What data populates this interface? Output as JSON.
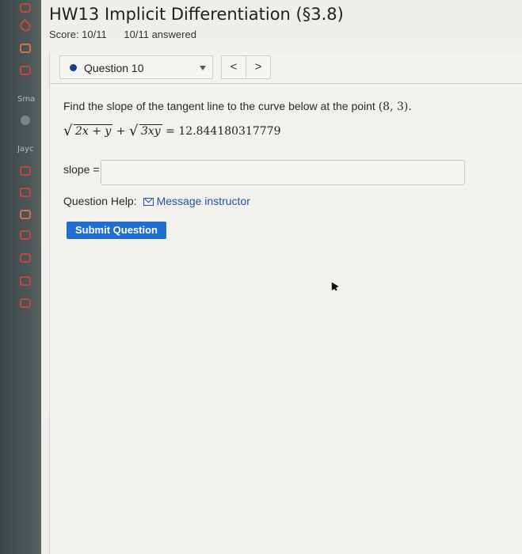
{
  "sidebar": {
    "labels": [
      "Sma",
      "Jayc"
    ]
  },
  "header": {
    "title": "HW13 Implicit Differentiation (§3.8)",
    "score": "Score: 10/11",
    "answered": "10/11 answered"
  },
  "question_nav": {
    "selected": "Question 10",
    "prev_label": "<",
    "next_label": ">"
  },
  "question": {
    "prompt_text": "Find the slope of the tangent line to the curve below at the point ",
    "point": "(8, 3).",
    "equation": {
      "radicand1": "2x + y",
      "plus": " + ",
      "radicand2": "3xy",
      "equals": " = 12.844180317779"
    },
    "answer_label": "slope =",
    "answer_value": "",
    "help_label": "Question Help:",
    "help_link": "Message instructor",
    "submit_label": "Submit Question"
  },
  "colors": {
    "accent": "#1e6fd0",
    "link": "#1f4fb0",
    "status_dot": "#1a3f8a"
  }
}
